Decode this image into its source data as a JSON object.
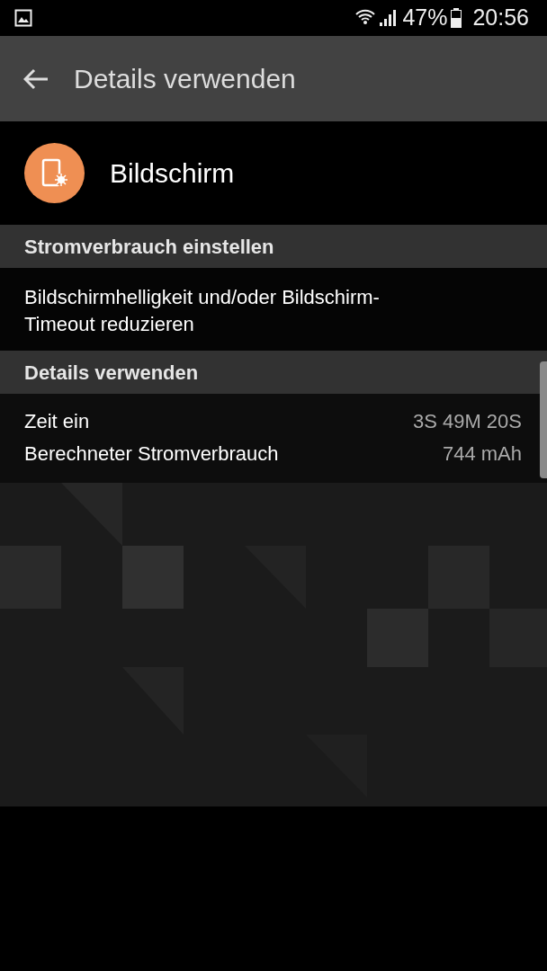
{
  "status_bar": {
    "battery": "47%",
    "time": "20:56"
  },
  "toolbar": {
    "title": "Details verwenden"
  },
  "app": {
    "name": "Bildschirm"
  },
  "sections": [
    {
      "header": "Stromverbrauch einstellen",
      "text": "Bildschirmhelligkeit und/oder Bildschirm-\nTimeout reduzieren"
    },
    {
      "header": "Details verwenden",
      "rows": [
        {
          "label": "Zeit ein",
          "value": "3S 49M 20S"
        },
        {
          "label": "Berechneter Stromverbrauch",
          "value": "744 mAh"
        }
      ]
    }
  ]
}
